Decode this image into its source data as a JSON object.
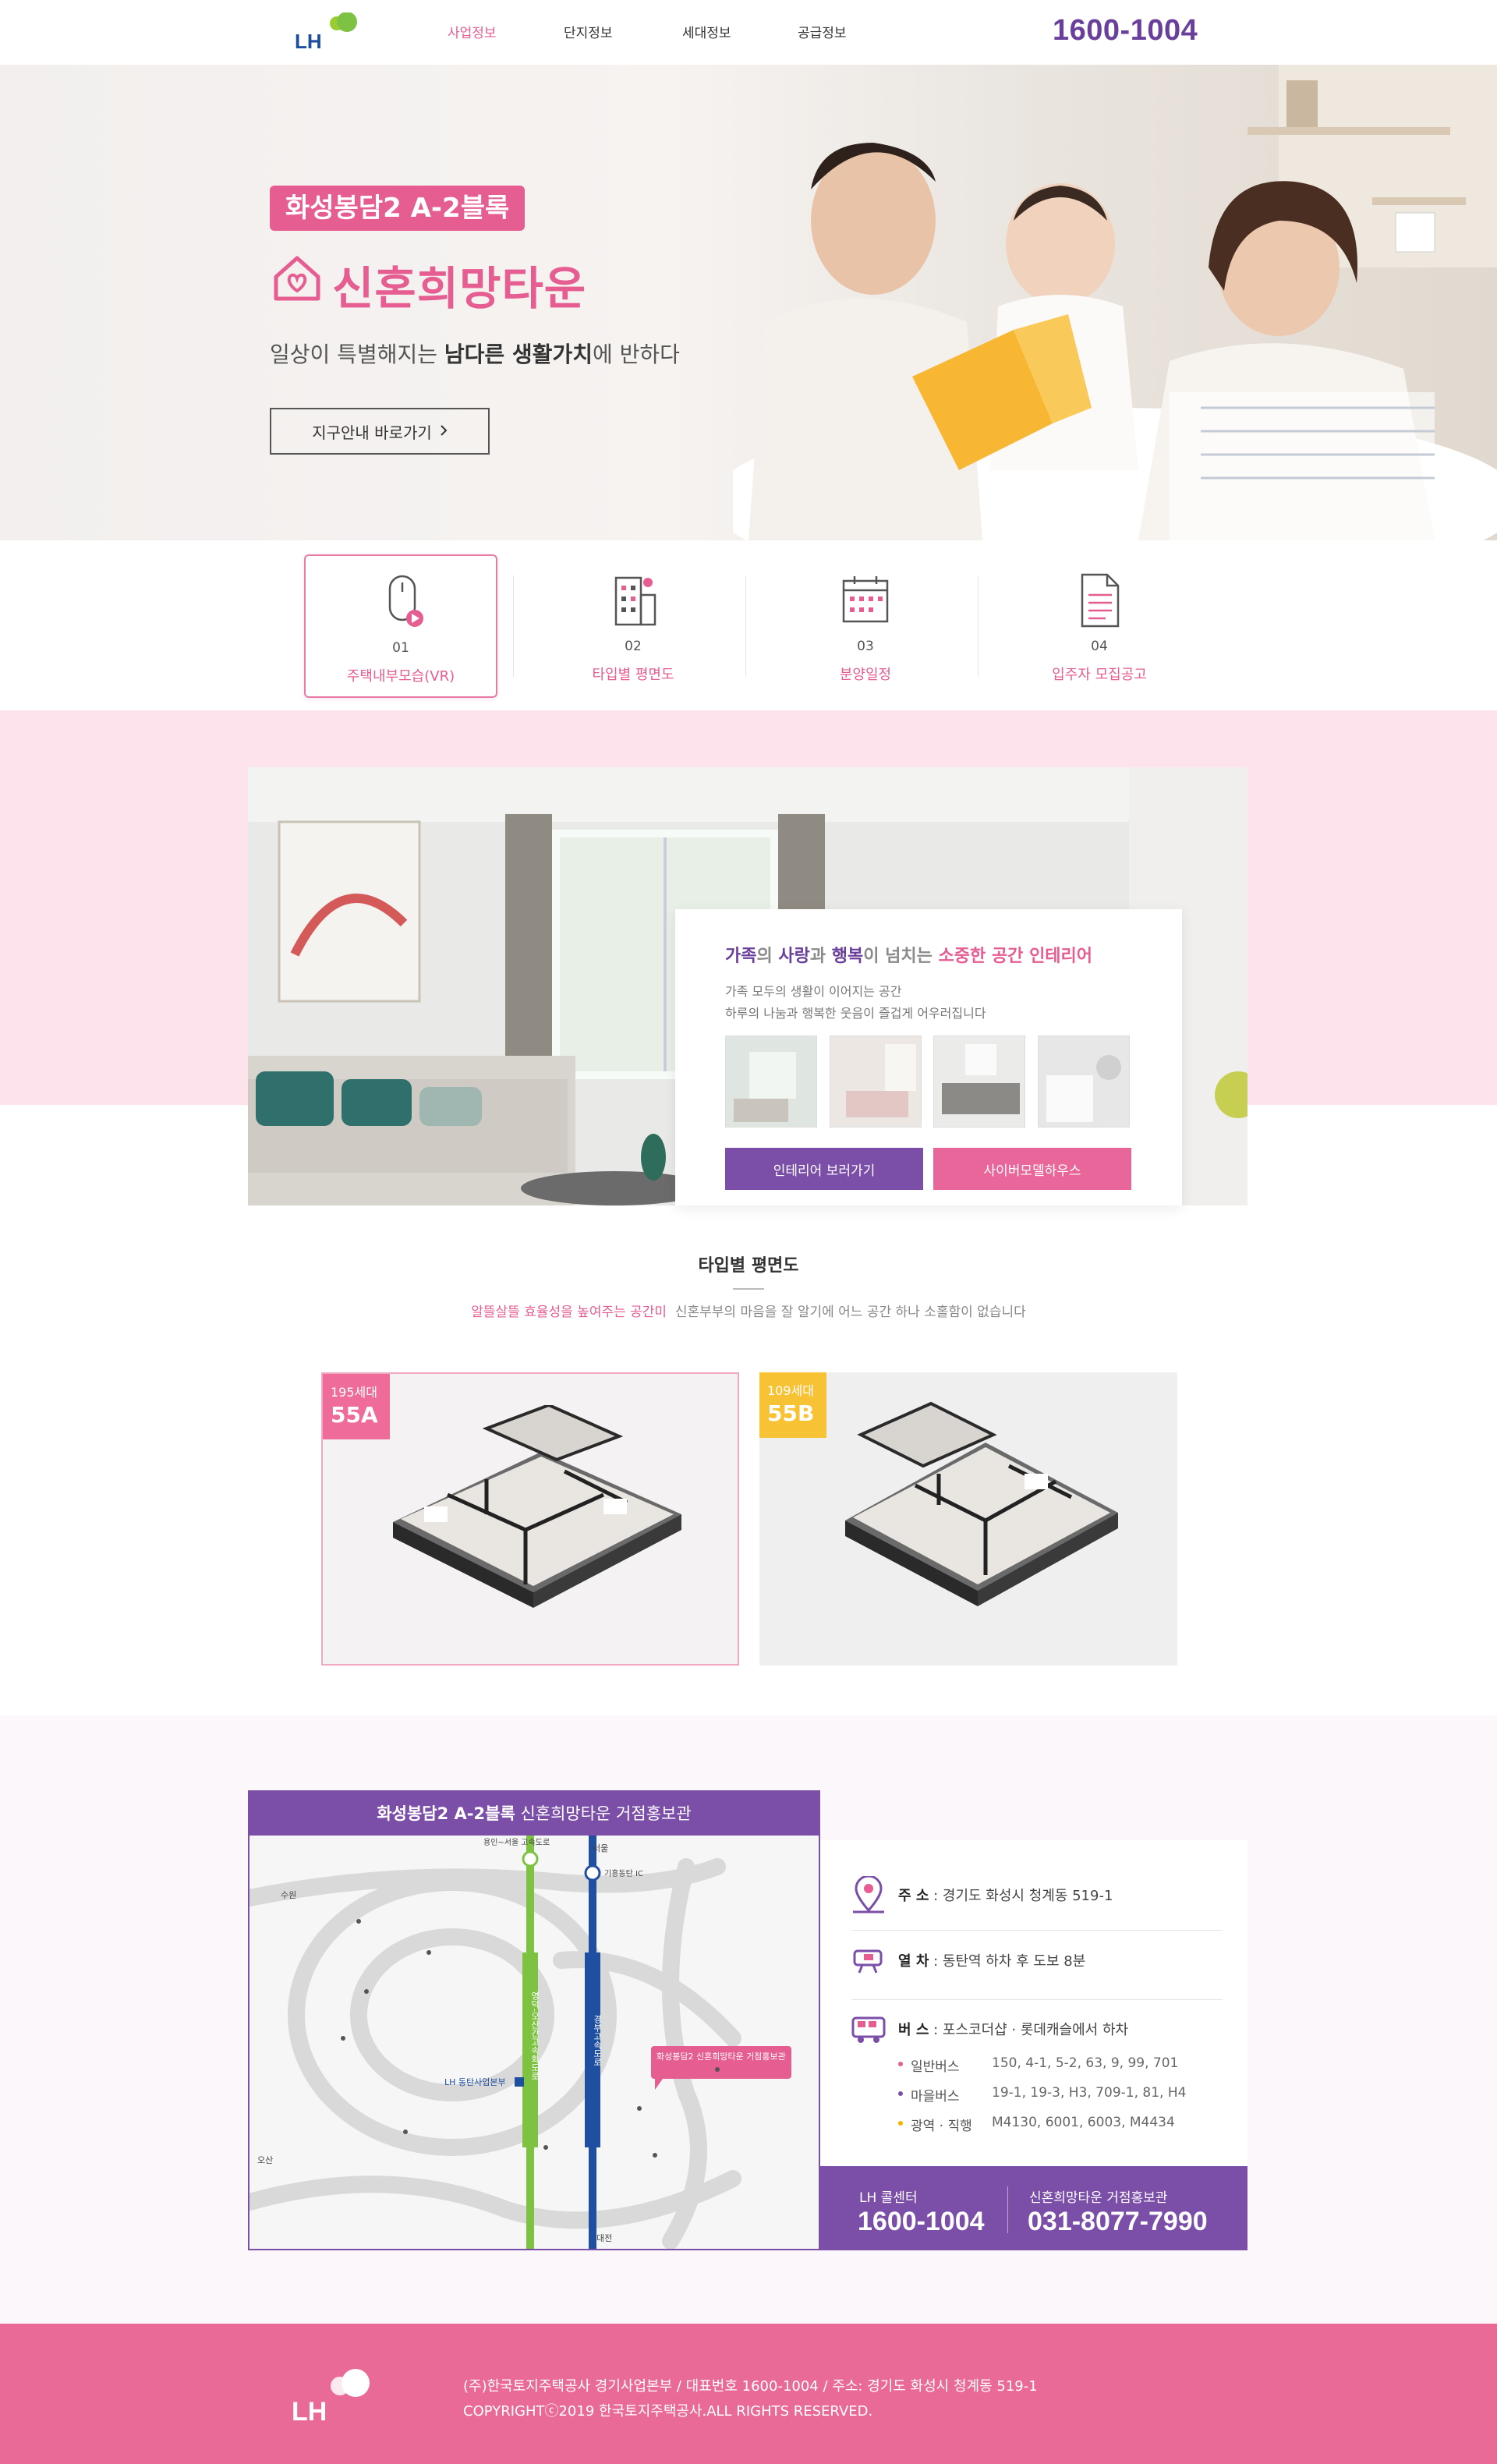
{
  "header": {
    "logo_text": "LH",
    "nav": [
      "사업정보",
      "단지정보",
      "세대정보",
      "공급정보"
    ],
    "phone": "1600-1004"
  },
  "hero": {
    "badge": "화성봉담2 A-2블록",
    "title": "신혼희망타운",
    "subtitle_prefix": "일상이 특별해지는 ",
    "subtitle_bold1": "남다른 생활가치",
    "subtitle_suffix": "에 반하다",
    "button_label": "지구안내 바로가기",
    "button_icon": "chevron-right-icon"
  },
  "quick_menu": [
    {
      "num": "01",
      "label": "주택내부모습(VR)",
      "icon": "mouse-play-icon"
    },
    {
      "num": "02",
      "label": "타입별 평면도",
      "icon": "building-icon"
    },
    {
      "num": "03",
      "label": "분양일정",
      "icon": "calendar-icon"
    },
    {
      "num": "04",
      "label": "입주자 모집공고",
      "icon": "document-icon"
    }
  ],
  "interior": {
    "title_parts": [
      "가족",
      "의 ",
      "사랑",
      "과 ",
      "행복",
      "이 넘치는 ",
      "소중한 공간 인테리어"
    ],
    "line1": "가족 모두의 생활이 이어지는 공간",
    "line2": "하루의 나눔과 행복한 웃음이 즐겁게 어우러집니다",
    "button_interior": "인테리어 보러가기",
    "button_model": "사이버모델하우스"
  },
  "floorplan": {
    "title": "타입별 평면도",
    "desc_pink": "알뜰살뜰 효율성을 높여주는 공간미",
    "desc_gray": "신혼부부의 마음을 잘 알기에 어느 공간 하나 소홀함이 없습니다",
    "types": [
      {
        "households": "195세대",
        "name": "55A",
        "color": "#ee6b9a"
      },
      {
        "households": "109세대",
        "name": "55B",
        "color": "#f7c233"
      }
    ]
  },
  "location": {
    "map_title_bold": "화성봉담2  A-2블록",
    "map_title_rest": " 신혼희망타운 거점홍보관",
    "map_labels": {
      "marker": "화성봉담2 신혼희망타운 거점홍보관",
      "office": "LH 동탄사업본부",
      "road_green": "영덕-오산간고속화도로",
      "road_blue": "경부고속도로",
      "seoul": "서울",
      "yongin": "용인~서울 고속도로",
      "osan": "오산",
      "daejeon": "대전",
      "suwon": "수원",
      "giheung": "기흥동탄 IC"
    },
    "address_label": "주 소",
    "address": "경기도 화성시 청계동 519-1",
    "train_label": "열 차",
    "train": "동탄역 하차 후 도보 8분",
    "bus_label": "버 스",
    "bus": "포스코더샵 · 롯데캐슬에서 하차",
    "bus_lines": [
      {
        "label": "일반버스",
        "value": "150, 4-1, 5-2, 63, 9, 99, 701",
        "color": "#e65d91"
      },
      {
        "label": "마을버스",
        "value": "19-1, 19-3, H3, 709-1, 81, H4",
        "color": "#7b4ea8"
      },
      {
        "label": "광역 · 직행",
        "value": "M4130, 6001, 6003, M4434",
        "color": "#f5b400"
      }
    ],
    "call_center_label": "LH 콜센터",
    "call_center": "1600-1004",
    "promo_label": "신혼희망타운 거점홍보관",
    "promo": "031-8077-7990"
  },
  "footer": {
    "line1": "(주)한국토지주택공사 경기사업본부  /  대표번호 1600-1004  /  주소: 경기도 화성시 청계동 519-1",
    "line2": "COPYRIGHTⓒ2019 한국토지주택공사.ALL RIGHTS RESERVED.",
    "logo_text": "LH"
  },
  "colors": {
    "pink": "#e65d91",
    "purple": "#7b4ea8",
    "yellow": "#f7c233",
    "footer": "#ea6a97"
  }
}
